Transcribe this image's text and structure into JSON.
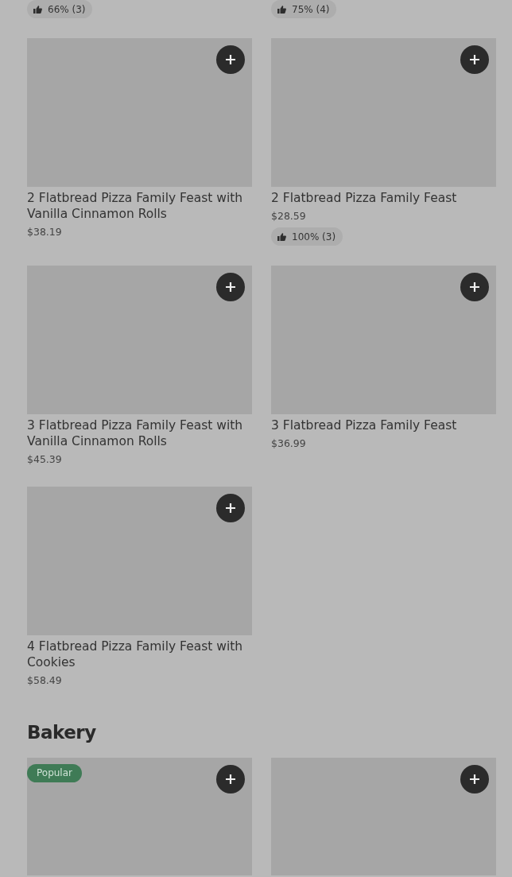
{
  "previous_row_ratings": [
    {
      "rating": "66% (3)"
    },
    {
      "rating": "75% (4)"
    }
  ],
  "items": [
    {
      "title": "2 Flatbread Pizza Family Feast with Vanilla Cinnamon Rolls",
      "price": "$38.19"
    },
    {
      "title": "2 Flatbread Pizza Family Feast",
      "price": "$28.59",
      "rating": "100% (3)"
    },
    {
      "title": "3 Flatbread Pizza Family Feast with Vanilla Cinnamon Rolls",
      "price": "$45.39"
    },
    {
      "title": "3 Flatbread Pizza Family Feast",
      "price": "$36.99"
    },
    {
      "title": "4 Flatbread Pizza Family Feast with Cookies",
      "price": "$58.49"
    }
  ],
  "bakery": {
    "heading": "Bakery",
    "items": [
      {
        "tag": "Popular",
        "add_button": true
      },
      {
        "add_button": true
      }
    ]
  }
}
